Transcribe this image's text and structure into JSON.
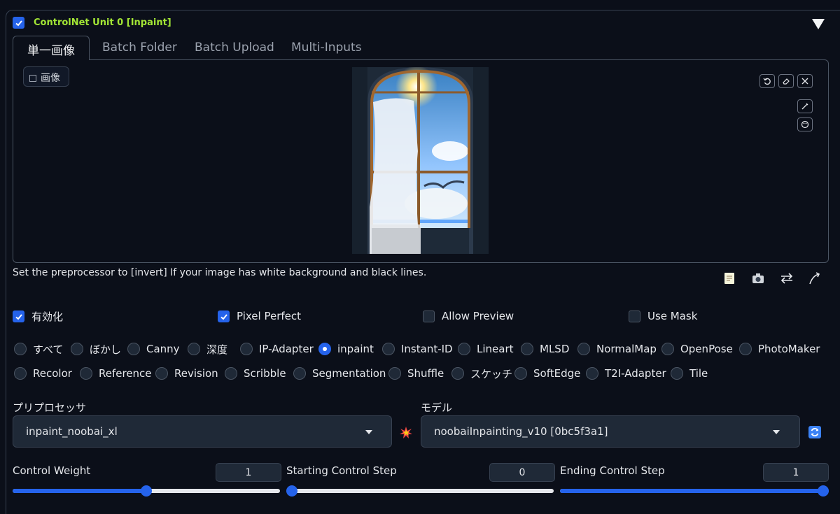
{
  "unit": {
    "enabled_checked": true,
    "title": "ControlNet Unit 0  [Inpaint]"
  },
  "tabs": [
    {
      "label": "単一画像",
      "active": true
    },
    {
      "label": "Batch Folder",
      "active": false
    },
    {
      "label": "Batch Upload",
      "active": false
    },
    {
      "label": "Multi-Inputs",
      "active": false
    }
  ],
  "image_input": {
    "label": "画像"
  },
  "hint": "Set the preprocessor to [invert] If your image has white background and black lines.",
  "options": {
    "enable": {
      "label": "有効化",
      "checked": true
    },
    "pixel_perfect": {
      "label": "Pixel Perfect",
      "checked": true
    },
    "allow_preview": {
      "label": "Allow Preview",
      "checked": false
    },
    "use_mask": {
      "label": "Use Mask",
      "checked": false
    }
  },
  "control_types": [
    "すべて",
    "ぼかし",
    "Canny",
    "深度",
    "IP-Adapter",
    "inpaint",
    "Instant-ID",
    "Lineart",
    "MLSD",
    "NormalMap",
    "OpenPose",
    "PhotoMaker",
    "Recolor",
    "Reference",
    "Revision",
    "Scribble",
    "Segmentation",
    "Shuffle",
    "スケッチ",
    "SoftEdge",
    "T2I-Adapter",
    "Tile"
  ],
  "selected_control_type": "inpaint",
  "preprocessor": {
    "label": "プリプロセッサ",
    "value": "inpaint_noobai_xl"
  },
  "model": {
    "label": "モデル",
    "value": "noobaiInpainting_v10 [0bc5f3a1]"
  },
  "control_weight": {
    "label": "Control Weight",
    "value": "1",
    "fraction": 0.5
  },
  "starting_step": {
    "label": "Starting Control Step",
    "value": "0",
    "fraction": 0.0
  },
  "ending_step": {
    "label": "Ending Control Step",
    "value": "1",
    "fraction": 1.0
  },
  "colors": {
    "accent": "#2563eb",
    "title": "#a3e635",
    "background": "#0b0f19"
  }
}
